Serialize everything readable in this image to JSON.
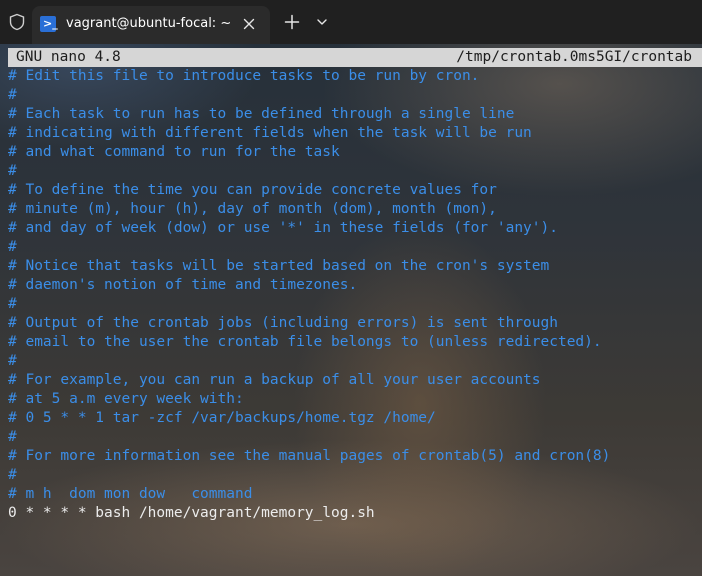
{
  "tab": {
    "title": "vagrant@ubuntu-focal: ~",
    "icon_glyph": ">_"
  },
  "nano": {
    "version_label": "GNU nano 4.8",
    "file_path": "/tmp/crontab.0ms5GI/crontab"
  },
  "lines": [
    {
      "text": "# Edit this file to introduce tasks to be run by cron.",
      "kind": "comment"
    },
    {
      "text": "#",
      "kind": "comment"
    },
    {
      "text": "# Each task to run has to be defined through a single line",
      "kind": "comment"
    },
    {
      "text": "# indicating with different fields when the task will be run",
      "kind": "comment"
    },
    {
      "text": "# and what command to run for the task",
      "kind": "comment"
    },
    {
      "text": "#",
      "kind": "comment"
    },
    {
      "text": "# To define the time you can provide concrete values for",
      "kind": "comment"
    },
    {
      "text": "# minute (m), hour (h), day of month (dom), month (mon),",
      "kind": "comment"
    },
    {
      "text": "# and day of week (dow) or use '*' in these fields (for 'any').",
      "kind": "comment"
    },
    {
      "text": "#",
      "kind": "comment"
    },
    {
      "text": "# Notice that tasks will be started based on the cron's system",
      "kind": "comment"
    },
    {
      "text": "# daemon's notion of time and timezones.",
      "kind": "comment"
    },
    {
      "text": "#",
      "kind": "comment"
    },
    {
      "text": "# Output of the crontab jobs (including errors) is sent through",
      "kind": "comment"
    },
    {
      "text": "# email to the user the crontab file belongs to (unless redirected).",
      "kind": "comment"
    },
    {
      "text": "#",
      "kind": "comment"
    },
    {
      "text": "# For example, you can run a backup of all your user accounts",
      "kind": "comment"
    },
    {
      "text": "# at 5 a.m every week with:",
      "kind": "comment"
    },
    {
      "text": "# 0 5 * * 1 tar -zcf /var/backups/home.tgz /home/",
      "kind": "comment"
    },
    {
      "text": "#",
      "kind": "comment"
    },
    {
      "text": "# For more information see the manual pages of crontab(5) and cron(8)",
      "kind": "comment"
    },
    {
      "text": "#",
      "kind": "comment"
    },
    {
      "text": "# m h  dom mon dow   command",
      "kind": "comment"
    },
    {
      "text": "0 * * * * bash /home/vagrant/memory_log.sh",
      "kind": "plain"
    }
  ],
  "icons": {
    "shield": "shield-icon",
    "terminal": "powershell-icon",
    "close": "close-icon",
    "new_tab": "plus-icon",
    "dropdown": "chevron-down-icon"
  },
  "colors": {
    "comment": "#3b8ee8",
    "plain_text": "#ececec",
    "status_bar_bg": "#d6d6d6",
    "tab_bg": "#2b2b2b",
    "titlebar_bg": "#202020"
  }
}
